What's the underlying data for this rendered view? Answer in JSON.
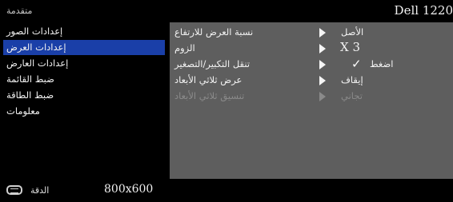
{
  "header": {
    "section": "متقدمة",
    "model": "Dell 1220"
  },
  "menu": {
    "items": [
      {
        "label": "إعدادات الصور"
      },
      {
        "label": "إعدادات العرض",
        "selected": true
      },
      {
        "label": "إعدادات العارض"
      },
      {
        "label": "ضبط القائمة"
      },
      {
        "label": "ضبط الطاقة"
      },
      {
        "label": "معلومات"
      }
    ]
  },
  "settings": {
    "rows": [
      {
        "label": "نسبة العرض للارتفاع",
        "value": "الأصل"
      },
      {
        "label": "الزوم",
        "value": "X 3"
      },
      {
        "label": "تنقل التكبير/التصغير",
        "value": "اضغط",
        "check": "✓"
      },
      {
        "label": "عرض ثلاثي الأبعاد",
        "value": "إيقاف"
      },
      {
        "label": "تنسيق ثلاثي الأبعاد",
        "value": "تجاني",
        "disabled": true
      }
    ]
  },
  "footer": {
    "resolution_icon": "resolution-icon",
    "resolution_label": "الدقة",
    "resolution_value": "800x600"
  },
  "colors": {
    "selected": "#1a3fa8",
    "panel": "#5e5e5e",
    "background": "#000000"
  }
}
